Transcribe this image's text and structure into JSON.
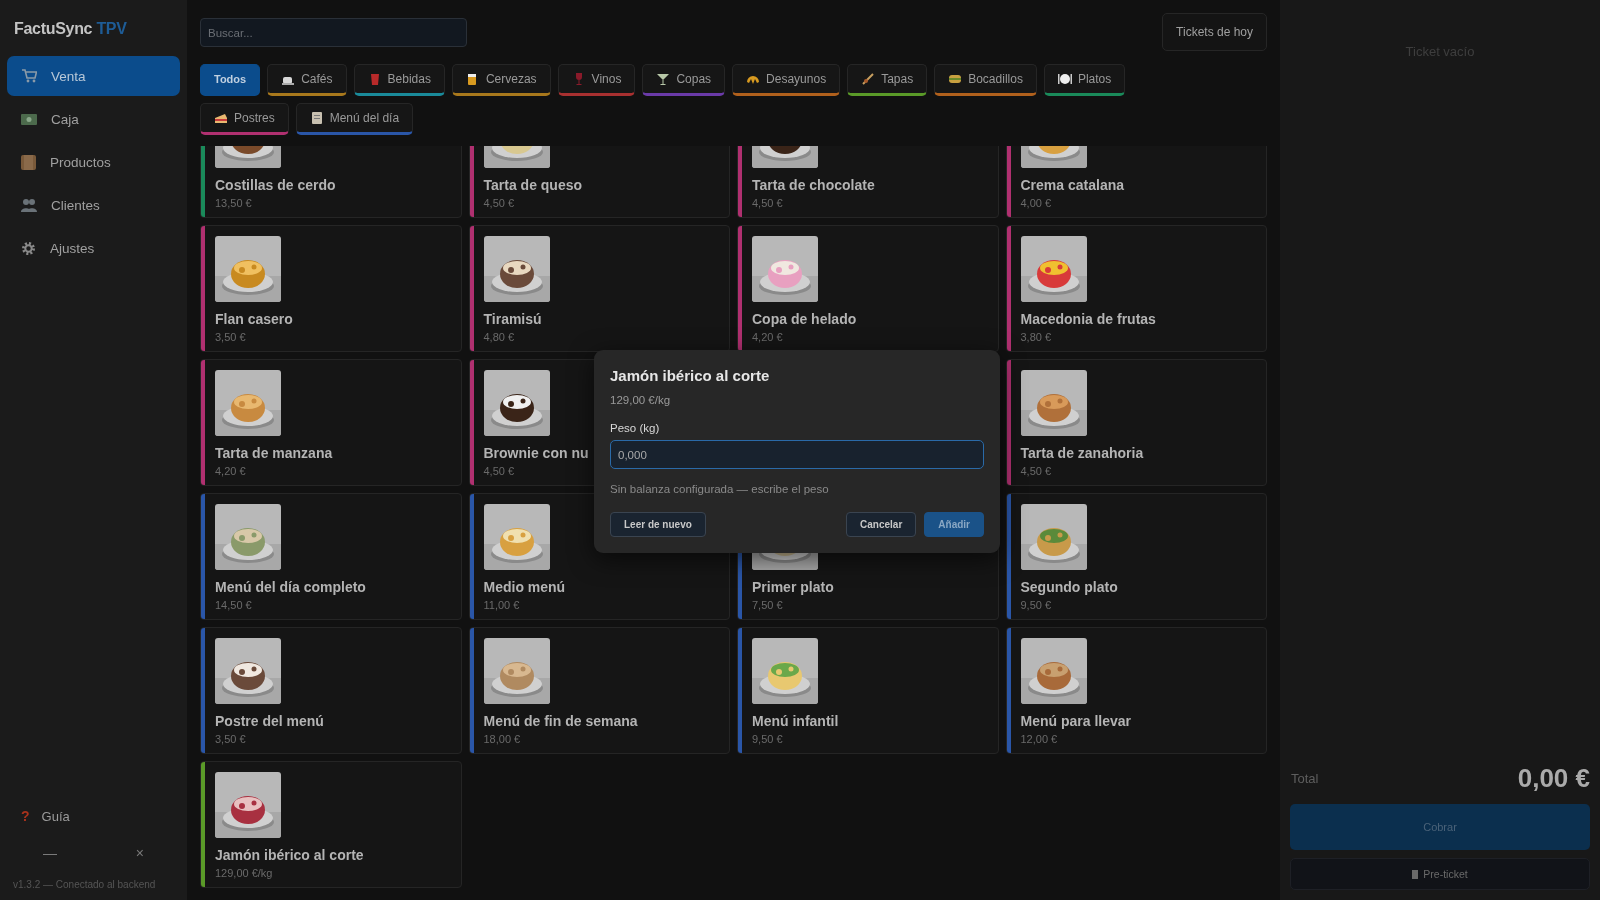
{
  "app": {
    "brand": "FactuSync",
    "brand_accent": "TPV"
  },
  "sidebar": {
    "items": [
      {
        "label": "Venta",
        "selected": true
      },
      {
        "label": "Caja",
        "selected": false
      },
      {
        "label": "Productos",
        "selected": false
      },
      {
        "label": "Clientes",
        "selected": false
      },
      {
        "label": "Ajustes",
        "selected": false
      }
    ],
    "guide": {
      "icon": "?",
      "label": "Guía"
    },
    "window_controls": [
      "—",
      "×"
    ],
    "status": "v1.3.2 — Conectado al backend"
  },
  "search": {
    "placeholder": "Buscar..."
  },
  "tickets_button": "Tickets de hoy",
  "categories": [
    {
      "label": "Todos",
      "selected": true
    },
    {
      "label": "Cafés",
      "selected": false,
      "color": "#a8781c"
    },
    {
      "label": "Bebidas",
      "selected": false,
      "color": "#1a8a9a"
    },
    {
      "label": "Cervezas",
      "selected": false,
      "color": "#a8781c"
    },
    {
      "label": "Vinos",
      "selected": false,
      "color": "#a83030"
    },
    {
      "label": "Copas",
      "selected": false,
      "color": "#6a3aa8"
    },
    {
      "label": "Desayunos",
      "selected": false,
      "color": "#b0601c"
    },
    {
      "label": "Tapas",
      "selected": false,
      "color": "#5a9a28"
    },
    {
      "label": "Bocadillos",
      "selected": false,
      "color": "#b0601c"
    },
    {
      "label": "Platos",
      "selected": false,
      "color": "#1a8a5a"
    },
    {
      "label": "Postres",
      "selected": false,
      "color": "#b03070"
    },
    {
      "label": "Menú del día",
      "selected": false,
      "color": "#2a56a8"
    }
  ],
  "products": [
    {
      "name": "Costillas de cerdo",
      "price": "13,50 €",
      "color": "#1a8a5a",
      "kind": "picture"
    },
    {
      "name": "Tarta de queso",
      "price": "4,50 €",
      "color": "#b03070",
      "kind": "picture"
    },
    {
      "name": "Tarta de chocolate",
      "price": "4,50 €",
      "color": "#b03070",
      "kind": "picture"
    },
    {
      "name": "Crema catalana",
      "price": "4,00 €",
      "color": "#b03070",
      "kind": "picture"
    },
    {
      "name": "Flan casero",
      "price": "3,50 €",
      "color": "#b03070",
      "kind": "picture"
    },
    {
      "name": "Tiramisú",
      "price": "4,80 €",
      "color": "#b03070",
      "kind": "picture"
    },
    {
      "name": "Copa de helado",
      "price": "4,20 €",
      "color": "#b03070",
      "kind": "picture"
    },
    {
      "name": "Macedonia de frutas",
      "price": "3,80 €",
      "color": "#b03070",
      "kind": "picture"
    },
    {
      "name": "Tarta de manzana",
      "price": "4,20 €",
      "color": "#b03070",
      "kind": "picture"
    },
    {
      "name": "Brownie con nu",
      "price": "4,50 €",
      "color": "#b03070",
      "kind": "picture"
    },
    {
      "name": "Tarta de zanahoria",
      "price": "4,50 €",
      "color": "#b03070",
      "kind": "picture"
    },
    {
      "name": "Menú del día completo",
      "price": "14,50 €",
      "color": "#2a56a8",
      "kind": "picture"
    },
    {
      "name": "Medio menú",
      "price": "11,00 €",
      "color": "#2a56a8",
      "kind": "picture"
    },
    {
      "name": "Primer plato",
      "price": "7,50 €",
      "color": "#2a56a8",
      "kind": "picture"
    },
    {
      "name": "Segundo plato",
      "price": "9,50 €",
      "color": "#2a56a8",
      "kind": "picture"
    },
    {
      "name": "Postre del menú",
      "price": "3,50 €",
      "color": "#2a56a8",
      "kind": "picture"
    },
    {
      "name": "Menú de fin de semana",
      "price": "18,00 €",
      "color": "#2a56a8",
      "kind": "picture"
    },
    {
      "name": "Menú infantil",
      "price": "9,50 €",
      "color": "#2a56a8",
      "kind": "picture"
    },
    {
      "name": "Menú para llevar",
      "price": "12,00 €",
      "color": "#2a56a8",
      "kind": "picture"
    },
    {
      "name": "Jamón ibérico al corte",
      "price": "129,00 €/kg",
      "color": "#5a9a28",
      "kind": "picture"
    }
  ],
  "ticket": {
    "empty_text": "Ticket vacío",
    "total_label": "Total",
    "total": "0,00 €",
    "pay_button": "Cobrar",
    "preticket_button": "Pre-ticket"
  },
  "dialog": {
    "title": "Jamón ibérico al corte",
    "price": "129,00 €/kg",
    "field_label": "Peso (kg)",
    "field_value": "0,000",
    "hint": "Sin balanza configurada — escribe el peso",
    "buttons": [
      {
        "label": "Leer de nuevo",
        "kind": "secondary"
      },
      {
        "label": "Cancelar",
        "kind": "cancel"
      },
      {
        "label": "Añadir",
        "kind": "primary"
      }
    ]
  }
}
